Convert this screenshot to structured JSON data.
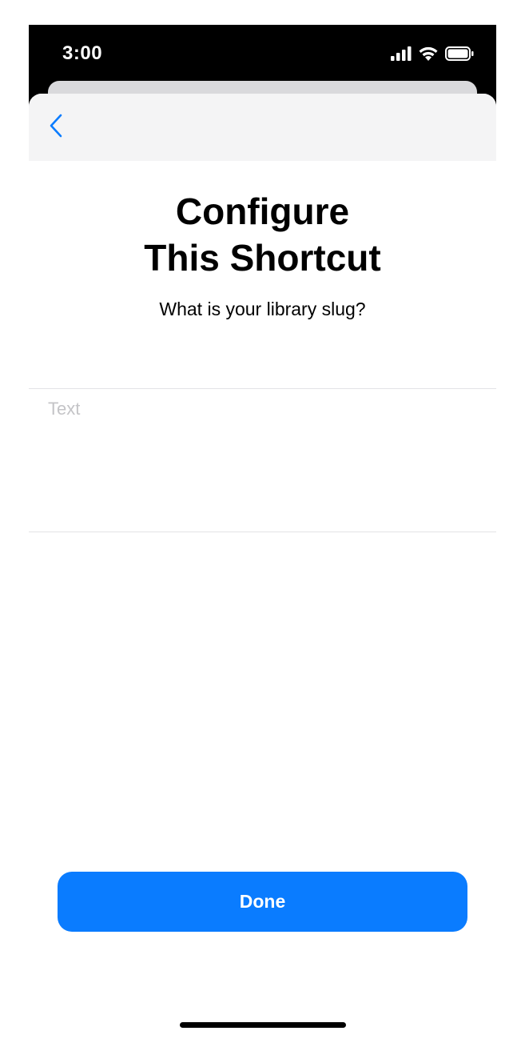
{
  "status_bar": {
    "time": "3:00",
    "icons": [
      "cellular-signal-icon",
      "wifi-icon",
      "battery-icon"
    ]
  },
  "nav": {
    "back_icon": "chevron-left-icon",
    "accent_color": "#0a7cff"
  },
  "content": {
    "title_line1": "Configure",
    "title_line2": "This Shortcut",
    "prompt": "What is your library slug?",
    "input_placeholder": "Text",
    "input_value": ""
  },
  "footer": {
    "done_label": "Done",
    "button_color": "#0a7cff"
  }
}
